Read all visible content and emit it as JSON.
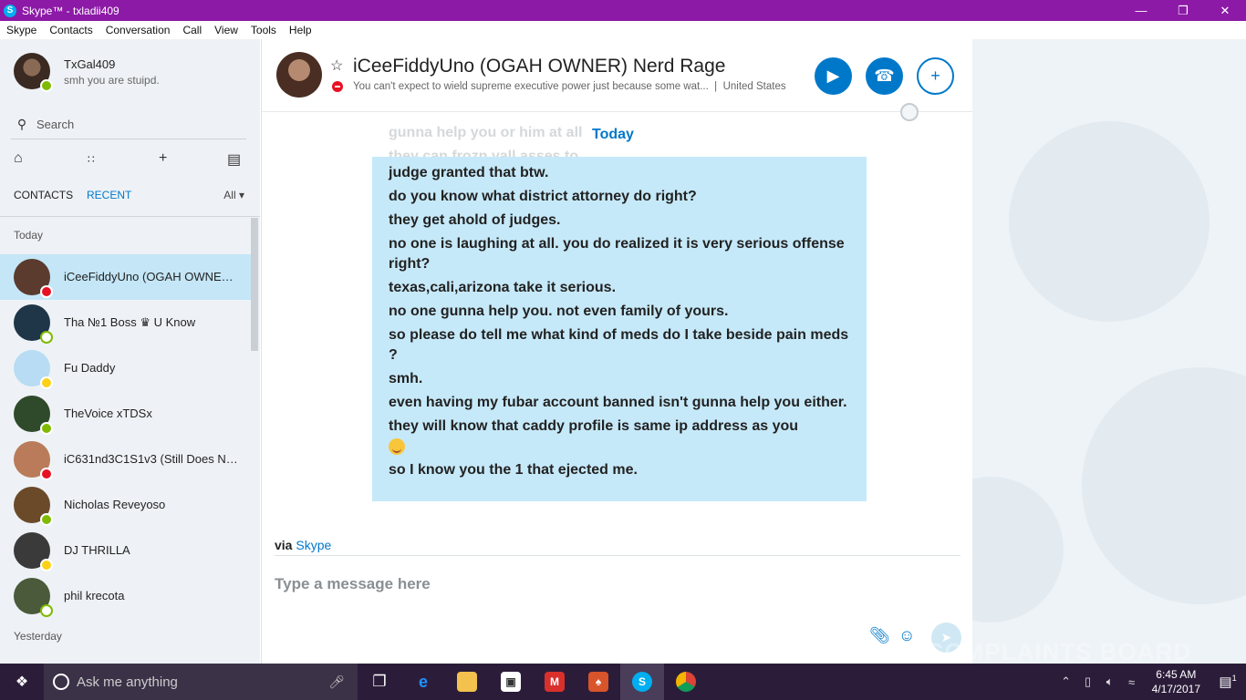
{
  "window": {
    "title": "Skype™ - txladii409",
    "controls": {
      "minimize": "—",
      "restore": "❐",
      "close": "✕"
    }
  },
  "menu": [
    "Skype",
    "Contacts",
    "Conversation",
    "Call",
    "View",
    "Tools",
    "Help"
  ],
  "profile": {
    "name": "TxGal409",
    "mood": "smh you are stuipd.",
    "status": "online"
  },
  "search": {
    "placeholder": "Search"
  },
  "sidebar_toolbar": [
    "home-icon",
    "dialpad-icon",
    "add-icon",
    "new-conversation-icon"
  ],
  "tabs": {
    "contacts": "CONTACTS",
    "recent": "RECENT",
    "filter": "All",
    "active": "recent"
  },
  "sections": {
    "today": "Today",
    "yesterday": "Yesterday"
  },
  "contacts": [
    {
      "name": "iCeeFiddyUno (OGAH OWNER)...",
      "status": "dnd",
      "color": "#5a3b2e",
      "active": true
    },
    {
      "name": "Tha №1 Boss ♛ U Know",
      "status": "offline",
      "color": "#1f3548",
      "active": false
    },
    {
      "name": "Fu Daddy",
      "status": "away",
      "color": "#b7dcf3",
      "active": false
    },
    {
      "name": "TheVoice xTDSx",
      "status": "online",
      "color": "#2f4a2a",
      "active": false
    },
    {
      "name": "iC631nd3C1S1v3 (Still Does No...",
      "status": "dnd",
      "color": "#b97b5a",
      "active": false
    },
    {
      "name": "Nicholas Reveyoso",
      "status": "online",
      "color": "#6b4a2a",
      "active": false
    },
    {
      "name": "DJ THRILLA",
      "status": "away",
      "color": "#3a3a3a",
      "active": false
    },
    {
      "name": "phil krecota",
      "status": "offline",
      "color": "#4a5a3a",
      "active": false
    }
  ],
  "conversation": {
    "title": "iCeeFiddyUno (OGAH OWNER) Nerd Rage",
    "status_message": "You can't expect to wield supreme executive power just because some wat...",
    "location": "United States",
    "status": "dnd",
    "date_divider": "Today",
    "faded_lines": [
      "gunna help you or him at all",
      "they can frozn yall asses to"
    ],
    "messages": [
      "judge  granted that btw.",
      "do you know what district attorney do right?",
      "they get  ahold of judges.",
      "no one is laughing at all. you do realized it is very serious offense right?",
      "texas,cali,arizona take it serious.",
      "no one gunna help you. not even family of yours.",
      "so please do tell me what kind of meds do I take beside pain meds ?",
      "smh.",
      "even having my fubar account banned isn't gunna help you either.",
      "they will know that caddy profile is same ip address as you",
      "so I know you the 1 that ejected me."
    ],
    "emoji_after_message": 9,
    "via_label": "via",
    "via_link": "Skype"
  },
  "composer": {
    "placeholder": "Type a message here"
  },
  "taskbar": {
    "search_placeholder": "Ask me anything",
    "apps": [
      "task-view-icon",
      "edge-icon",
      "file-explorer-icon",
      "store-icon",
      "office-icon",
      "app-icon",
      "skype-icon",
      "chrome-icon"
    ],
    "active_app": "skype-icon",
    "time": "6:45 AM",
    "date": "4/17/2017",
    "notification_count": "1"
  },
  "watermark": "COMPLAINTS BOARD",
  "colors": {
    "titlebar": "#8c1aa6",
    "accent": "#0078ca",
    "bubble": "#c6e9f9",
    "active_row": "#c4e6f7",
    "taskbar": "#2b1d3a"
  }
}
